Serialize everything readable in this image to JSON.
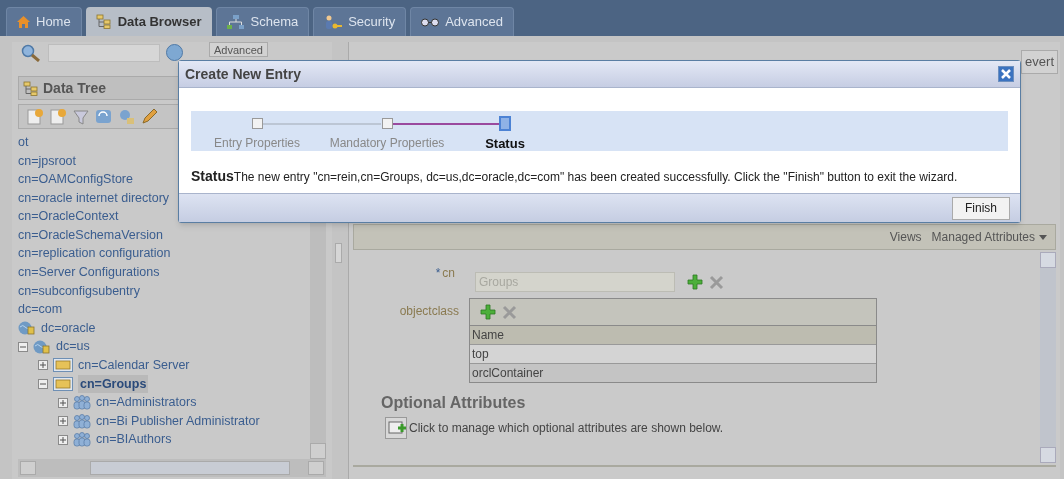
{
  "tabs": [
    {
      "label": "Home",
      "kind": "home",
      "selected": false
    },
    {
      "label": "Data Browser",
      "kind": "tree",
      "selected": true
    },
    {
      "label": "Schema",
      "kind": "schema",
      "selected": false
    },
    {
      "label": "Security",
      "kind": "key",
      "selected": false
    },
    {
      "label": "Advanced",
      "kind": "glasses",
      "selected": false
    }
  ],
  "left_panel": {
    "advanced_button": "Advanced",
    "title": "Data Tree",
    "tree": [
      {
        "label": "ot",
        "kind": "plain",
        "selected": false
      },
      {
        "label": "cn=jpsroot",
        "kind": "plain",
        "selected": false
      },
      {
        "label": "cn=OAMConfigStore",
        "kind": "plain",
        "selected": false
      },
      {
        "label": "cn=oracle internet directory",
        "kind": "plain",
        "selected": false
      },
      {
        "label": "cn=OracleContext",
        "kind": "plain",
        "selected": false
      },
      {
        "label": "cn=OracleSchemaVersion",
        "kind": "plain",
        "selected": false
      },
      {
        "label": "cn=replication configuration",
        "kind": "plain",
        "selected": false
      },
      {
        "label": "cn=Server Configurations",
        "kind": "plain",
        "selected": false
      },
      {
        "label": "cn=subconfigsubentry",
        "kind": "plain",
        "selected": false
      },
      {
        "label": "dc=com",
        "kind": "plain",
        "selected": false
      },
      {
        "label": "dc=oracle",
        "kind": "domain",
        "selected": false
      },
      {
        "label": "dc=us",
        "kind": "domain",
        "selected": false,
        "expanded": true,
        "children": [
          {
            "label": "cn=Calendar Server",
            "kind": "container",
            "selected": false,
            "expanded": false
          },
          {
            "label": "cn=Groups",
            "kind": "container",
            "selected": true,
            "expanded": true,
            "children": [
              {
                "label": "cn=Administrators",
                "kind": "group",
                "selected": false,
                "expanded": false
              },
              {
                "label": "cn=Bi Publisher Administrator",
                "kind": "group",
                "selected": false,
                "expanded": false
              },
              {
                "label": "cn=BIAuthors",
                "kind": "group",
                "selected": false,
                "expanded": false
              }
            ]
          }
        ]
      }
    ]
  },
  "right_panel": {
    "revert_button": "evert",
    "views_label": "Views",
    "views_menu": "Managed Attributes",
    "cn_label": "cn",
    "cn_required_mark": "*",
    "cn_value": "Groups",
    "objectclass_label": "objectclass",
    "objectclass_column": "Name",
    "objectclass_rows": [
      {
        "value": "top",
        "selected": false
      },
      {
        "value": "orclContainer",
        "selected": true
      }
    ],
    "optional_title": "Optional Attributes",
    "optional_hint": "Click to manage which optional attributes are shown below."
  },
  "dialog": {
    "title": "Create New Entry",
    "steps": [
      {
        "label": "Entry Properties",
        "selected": false
      },
      {
        "label": "Mandatory Properties",
        "selected": false
      },
      {
        "label": "Status",
        "selected": true
      }
    ],
    "message": "**Status**The new entry \"cn=rein,cn=Groups, dc=us,dc=oracle,dc=com\" has been created successfully. Click the \"Finish\" button to exit the wizard.",
    "finish_button": "Finish"
  }
}
